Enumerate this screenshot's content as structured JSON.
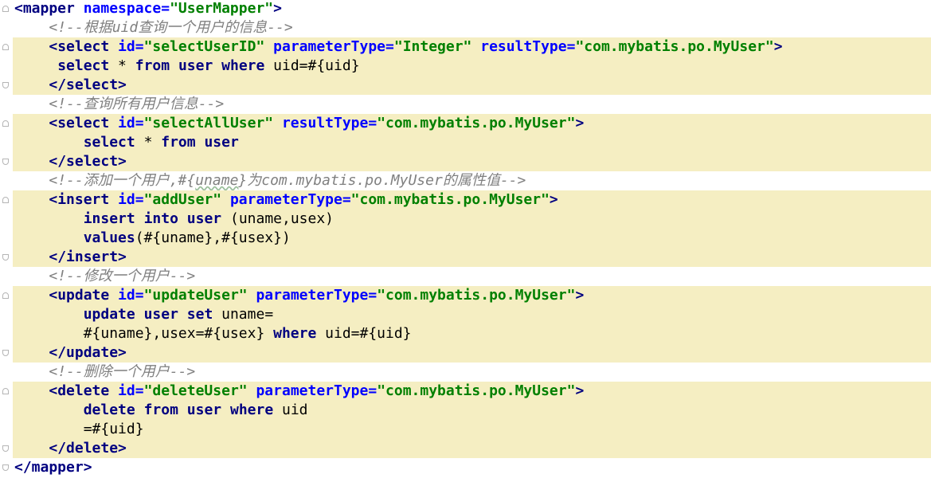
{
  "editor": {
    "lines": [
      {
        "indent": "",
        "segments": [
          {
            "t": "<mapper ",
            "c": "tag"
          },
          {
            "t": "namespace=",
            "c": "attr"
          },
          {
            "t": "\"UserMapper\"",
            "c": "val"
          },
          {
            "t": ">",
            "c": "tag"
          }
        ],
        "hl": false,
        "fold": "start"
      },
      {
        "indent": "    ",
        "segments": [
          {
            "t": "<!--根据uid查询一个用户的信息-->",
            "c": "cm"
          }
        ],
        "hl": false,
        "fold": ""
      },
      {
        "indent": "    ",
        "segments": [
          {
            "t": "<select ",
            "c": "tag"
          },
          {
            "t": "id=",
            "c": "attr"
          },
          {
            "t": "\"selectUserID\" ",
            "c": "val"
          },
          {
            "t": "parameterType=",
            "c": "attr"
          },
          {
            "t": "\"Integer\" ",
            "c": "val"
          },
          {
            "t": "resultType=",
            "c": "attr"
          },
          {
            "t": "\"com.mybatis.po.MyUser\"",
            "c": "val"
          },
          {
            "t": ">",
            "c": "tag"
          }
        ],
        "hl": true,
        "fold": "start"
      },
      {
        "indent": "     ",
        "segments": [
          {
            "t": "select",
            "c": "kw"
          },
          {
            "t": " * ",
            "c": "txt"
          },
          {
            "t": "from",
            "c": "kw"
          },
          {
            "t": " ",
            "c": "txt"
          },
          {
            "t": "user",
            "c": "kw"
          },
          {
            "t": " ",
            "c": "txt"
          },
          {
            "t": "where",
            "c": "kw"
          },
          {
            "t": " uid=#{uid}",
            "c": "txt"
          }
        ],
        "hl": true,
        "fold": ""
      },
      {
        "indent": "    ",
        "segments": [
          {
            "t": "</select>",
            "c": "tag"
          }
        ],
        "hl": true,
        "fold": "end"
      },
      {
        "indent": "    ",
        "segments": [
          {
            "t": "<!--查询所有用户信息-->",
            "c": "cm"
          }
        ],
        "hl": false,
        "fold": ""
      },
      {
        "indent": "    ",
        "segments": [
          {
            "t": "<select ",
            "c": "tag"
          },
          {
            "t": "id=",
            "c": "attr"
          },
          {
            "t": "\"selectAllUser\" ",
            "c": "val"
          },
          {
            "t": "resultType=",
            "c": "attr"
          },
          {
            "t": "\"com.mybatis.po.MyUser\"",
            "c": "val"
          },
          {
            "t": ">",
            "c": "tag"
          }
        ],
        "hl": true,
        "fold": "start"
      },
      {
        "indent": "        ",
        "segments": [
          {
            "t": "select",
            "c": "kw"
          },
          {
            "t": " * ",
            "c": "txt"
          },
          {
            "t": "from",
            "c": "kw"
          },
          {
            "t": " ",
            "c": "txt"
          },
          {
            "t": "user",
            "c": "kw"
          }
        ],
        "hl": true,
        "fold": ""
      },
      {
        "indent": "    ",
        "segments": [
          {
            "t": "</select>",
            "c": "tag"
          }
        ],
        "hl": true,
        "fold": "end"
      },
      {
        "indent": "    ",
        "segments": [
          {
            "t": "<!--添加一个用户,#{",
            "c": "cm"
          },
          {
            "t": "uname",
            "c": "cm wavy"
          },
          {
            "t": "}为com.mybatis.po.MyUser的属性值-->",
            "c": "cm"
          }
        ],
        "hl": false,
        "fold": ""
      },
      {
        "indent": "    ",
        "segments": [
          {
            "t": "<insert ",
            "c": "tag"
          },
          {
            "t": "id=",
            "c": "attr"
          },
          {
            "t": "\"addUser\" ",
            "c": "val"
          },
          {
            "t": "parameterType=",
            "c": "attr"
          },
          {
            "t": "\"com.mybatis.po.MyUser\"",
            "c": "val"
          },
          {
            "t": ">",
            "c": "tag"
          }
        ],
        "hl": true,
        "fold": "start"
      },
      {
        "indent": "        ",
        "segments": [
          {
            "t": "insert",
            "c": "kw"
          },
          {
            "t": " ",
            "c": "txt"
          },
          {
            "t": "into",
            "c": "kw"
          },
          {
            "t": " ",
            "c": "txt"
          },
          {
            "t": "user",
            "c": "kw"
          },
          {
            "t": " (uname,usex)",
            "c": "txt"
          }
        ],
        "hl": true,
        "fold": ""
      },
      {
        "indent": "        ",
        "segments": [
          {
            "t": "values",
            "c": "kw"
          },
          {
            "t": "(#{uname},#{usex})",
            "c": "txt"
          }
        ],
        "hl": true,
        "fold": ""
      },
      {
        "indent": "    ",
        "segments": [
          {
            "t": "</insert>",
            "c": "tag"
          }
        ],
        "hl": true,
        "fold": "end"
      },
      {
        "indent": "    ",
        "segments": [
          {
            "t": "<!--修改一个用户-->",
            "c": "cm"
          }
        ],
        "hl": false,
        "fold": ""
      },
      {
        "indent": "    ",
        "segments": [
          {
            "t": "<update ",
            "c": "tag"
          },
          {
            "t": "id=",
            "c": "attr"
          },
          {
            "t": "\"updateUser\" ",
            "c": "val"
          },
          {
            "t": "parameterType=",
            "c": "attr"
          },
          {
            "t": "\"com.mybatis.po.MyUser\"",
            "c": "val"
          },
          {
            "t": ">",
            "c": "tag"
          }
        ],
        "hl": true,
        "fold": "start"
      },
      {
        "indent": "        ",
        "segments": [
          {
            "t": "update",
            "c": "kw"
          },
          {
            "t": " ",
            "c": "txt"
          },
          {
            "t": "user",
            "c": "kw"
          },
          {
            "t": " ",
            "c": "txt"
          },
          {
            "t": "set",
            "c": "kw"
          },
          {
            "t": " uname=",
            "c": "txt"
          }
        ],
        "hl": true,
        "fold": ""
      },
      {
        "indent": "        ",
        "segments": [
          {
            "t": "#{uname},usex=#{usex} ",
            "c": "txt"
          },
          {
            "t": "where",
            "c": "kw"
          },
          {
            "t": " uid=#{uid}",
            "c": "txt"
          }
        ],
        "hl": true,
        "fold": ""
      },
      {
        "indent": "    ",
        "segments": [
          {
            "t": "</update>",
            "c": "tag"
          }
        ],
        "hl": true,
        "fold": "end"
      },
      {
        "indent": "    ",
        "segments": [
          {
            "t": "<!--删除一个用户-->",
            "c": "cm"
          }
        ],
        "hl": false,
        "fold": ""
      },
      {
        "indent": "    ",
        "segments": [
          {
            "t": "<delete ",
            "c": "tag"
          },
          {
            "t": "id=",
            "c": "attr"
          },
          {
            "t": "\"deleteUser\" ",
            "c": "val"
          },
          {
            "t": "parameterType=",
            "c": "attr"
          },
          {
            "t": "\"com.mybatis.po.MyUser\"",
            "c": "val"
          },
          {
            "t": ">",
            "c": "tag"
          }
        ],
        "hl": true,
        "fold": "start"
      },
      {
        "indent": "        ",
        "segments": [
          {
            "t": "delete",
            "c": "kw"
          },
          {
            "t": " ",
            "c": "txt"
          },
          {
            "t": "from",
            "c": "kw"
          },
          {
            "t": " ",
            "c": "txt"
          },
          {
            "t": "user",
            "c": "kw"
          },
          {
            "t": " ",
            "c": "txt"
          },
          {
            "t": "where",
            "c": "kw"
          },
          {
            "t": " uid",
            "c": "txt"
          }
        ],
        "hl": true,
        "fold": ""
      },
      {
        "indent": "        ",
        "segments": [
          {
            "t": "=#{uid}",
            "c": "txt"
          }
        ],
        "hl": true,
        "fold": ""
      },
      {
        "indent": "    ",
        "segments": [
          {
            "t": "</delete>",
            "c": "tag"
          }
        ],
        "hl": true,
        "fold": "end"
      },
      {
        "indent": "",
        "segments": [
          {
            "t": "</mapper>",
            "c": "tag"
          }
        ],
        "hl": false,
        "fold": "end"
      }
    ]
  },
  "colors": {
    "tag": "#000080",
    "attr": "#0000ff",
    "value": "#008000",
    "comment": "#808080",
    "highlight": "#f5eec2"
  }
}
